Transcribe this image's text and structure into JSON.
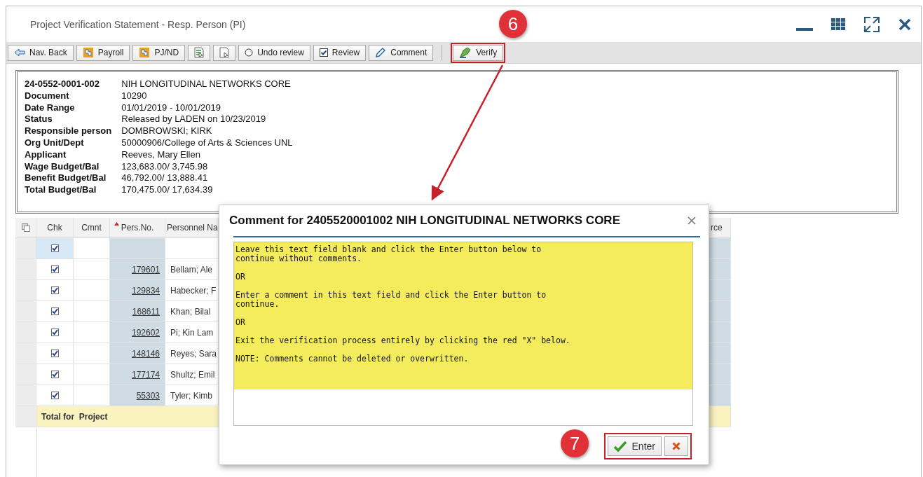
{
  "window": {
    "title": "Project Verification Statement - Resp. Person (PI)"
  },
  "toolbar": {
    "buttons": [
      {
        "label": "Nav. Back",
        "highlighted": false
      },
      {
        "label": "Payroll",
        "highlighted": false
      },
      {
        "label": "PJ/ND",
        "highlighted": false
      },
      {
        "highlighted": false
      },
      {
        "highlighted": false
      },
      {
        "label": "Undo review",
        "highlighted": false
      },
      {
        "label": "Review",
        "highlighted": false
      },
      {
        "label": "Comment",
        "highlighted": false
      },
      {
        "label": "Verify",
        "highlighted": true
      }
    ]
  },
  "header": {
    "fields": [
      {
        "label": "24-0552-0001-002",
        "value": "NIH LONGITUDINAL NETWORKS CORE"
      },
      {
        "label": "Document",
        "value": "10290"
      },
      {
        "label": "Date Range",
        "value": "01/01/2019 - 10/01/2019"
      },
      {
        "label": "Status",
        "value": "Released by LADEN on 10/23/2019"
      },
      {
        "label": "Responsible person",
        "value": "DOMBROWSKI; KIRK"
      },
      {
        "label": "Org Unit/Dept",
        "value": "50000906/College of Arts & Sciences UNL"
      },
      {
        "label": "Applicant",
        "value": "Reeves, Mary Ellen"
      },
      {
        "label": "Wage Budget/Bal",
        "value": "123,683.00/ 3,745.98"
      },
      {
        "label": "Benefit Budget/Bal",
        "value": "46,792.00/ 13,888.41"
      },
      {
        "label": "Total Budget/Bal",
        "value": "170,475.00/ 17,634.39"
      }
    ]
  },
  "table": {
    "columns": [
      {
        "label": "Chk",
        "sorted": false
      },
      {
        "label": "Cmnt",
        "sorted": false
      },
      {
        "label": "Pers.No.",
        "sorted": true
      },
      {
        "label": "Personnel Na",
        "sorted": false
      },
      {
        "label": "rce",
        "sorted": false
      }
    ],
    "rows": [
      {
        "checked": true,
        "selected": true,
        "pers_no": null,
        "name": null
      },
      {
        "checked": true,
        "selected": false,
        "pers_no": "179601",
        "name": "Bellam; Ale"
      },
      {
        "checked": true,
        "selected": false,
        "pers_no": "129834",
        "name": "Habecker; F"
      },
      {
        "checked": true,
        "selected": false,
        "pers_no": "168611",
        "name": "Khan; Bilal"
      },
      {
        "checked": true,
        "selected": false,
        "pers_no": "192602",
        "name": "Pi; Kin Lam"
      },
      {
        "checked": true,
        "selected": false,
        "pers_no": "148146",
        "name": "Reyes; Sara"
      },
      {
        "checked": true,
        "selected": false,
        "pers_no": "177174",
        "name": "Shultz; Emil"
      },
      {
        "checked": true,
        "selected": false,
        "pers_no": "55303",
        "name": "Tyler; Kimb"
      }
    ],
    "total_label": "Total for  Project"
  },
  "dialog": {
    "title": "Comment for 2405520001002 NIH LONGITUDINAL NETWORKS CORE",
    "comment": "Leave this text field blank and click the Enter button below to\ncontinue without comments.\n\nOR\n\nEnter a comment in this text field and click the Enter button to\ncontinue.\n\nOR\n\nExit the verification process entirely by clicking the red \"X\" below.\n\nNOTE: Comments cannot be deleted or overwritten.",
    "enter_label": "Enter",
    "actions_highlighted": true
  },
  "callouts": [
    {
      "number": "6"
    },
    {
      "number": "7"
    }
  ]
}
